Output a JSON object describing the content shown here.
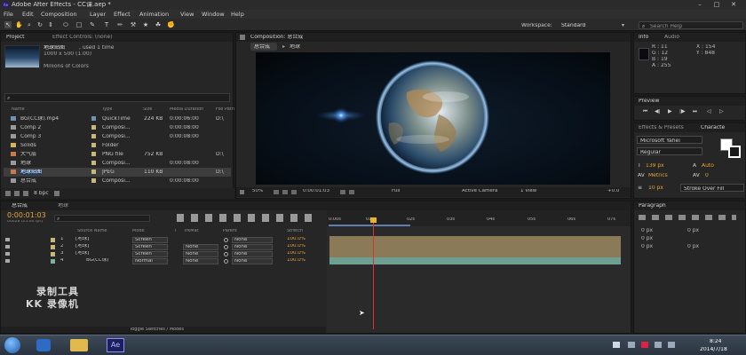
{
  "titlebar": {
    "icon_text": "Ae",
    "title": "Adobe After Effects - CC课.aep *"
  },
  "menubar": {
    "items": [
      "File",
      "Edit",
      "Composition",
      "Layer",
      "Effect",
      "Animation",
      "View",
      "Window",
      "Help"
    ]
  },
  "toolbar": {
    "tools": [
      "↖",
      "✋",
      "⌕",
      "↻",
      "⇕",
      "⬭",
      "□",
      "✎",
      "T",
      "✏",
      "⚒",
      "★",
      "☘",
      "✊"
    ],
    "workspace_label": "Workspace:",
    "workspace_value": "Standard",
    "search_placeholder": "Search Help"
  },
  "project": {
    "tabs": [
      "Project",
      "Effect Controls: (none)"
    ],
    "selected_name": "地球贴图",
    "used_text": ", used 1 time",
    "dimensions": "1000 x 500 (1.00)",
    "color_text": "Millions of Colors",
    "search_icon": "⌕",
    "columns": [
      "Name",
      "Type",
      "Size",
      "Media Duration",
      "File Path"
    ],
    "rows": [
      {
        "name": "BG(CC球).mp4",
        "type": "QuickTime",
        "size": "224 KB",
        "duration": "0:00:06:00",
        "path": "D:\\",
        "color": "#6f8fb3"
      },
      {
        "name": "Comp 2",
        "type": "Composi...",
        "size": "",
        "duration": "0:00:08:00",
        "path": "",
        "color": "#c9b77a"
      },
      {
        "name": "Comp 3",
        "type": "Composi...",
        "size": "",
        "duration": "0:00:08:00",
        "path": "",
        "color": "#c9b77a"
      },
      {
        "name": "Solids",
        "type": "Folder",
        "size": "",
        "duration": "",
        "path": "",
        "color": "#c9b77a"
      },
      {
        "name": "大气层",
        "type": "PNG file",
        "size": "752 KB",
        "duration": "",
        "path": "D:\\",
        "color": "#c9b77a"
      },
      {
        "name": "地球",
        "type": "Composi...",
        "size": "",
        "duration": "0:00:08:00",
        "path": "",
        "color": "#c9b77a"
      },
      {
        "name": "地球贴图",
        "type": "JPEG",
        "size": "110 KB",
        "duration": "",
        "path": "D:\\",
        "color": "#c9b77a",
        "selected": true
      },
      {
        "name": "总合成",
        "type": "Composi...",
        "size": "",
        "duration": "0:00:08:00",
        "path": "",
        "color": "#c9b77a"
      }
    ],
    "bpc": "8 bpc"
  },
  "comp": {
    "tab": "Composition: 总合成",
    "breadcrumbs": [
      "总合成",
      "地球"
    ],
    "controls": [
      "50%",
      "0:00:01:03",
      "Full",
      "Active Camera",
      "1 View",
      "+0.0"
    ]
  },
  "info": {
    "tabs": [
      "Info",
      "Audio"
    ],
    "r": "R : 11",
    "g": "G : 12",
    "b": "B : 19",
    "a": "A : 255",
    "x": "X : 154",
    "y": "Y : 848"
  },
  "preview": {
    "tab": "Preview",
    "buttons": [
      "⏮",
      "◀|",
      "▶",
      "|▶",
      "⏭",
      "◁",
      "▷"
    ]
  },
  "character": {
    "tabs": [
      "Effects & Presets",
      "Characte"
    ],
    "font": "Microsoft Yahei",
    "style": "Regular",
    "size": "139 px",
    "leading": "Auto",
    "kerning": "Metrics",
    "tracking": "0",
    "stroke_width": "10 px",
    "stroke_mode": "Stroke Over Fill"
  },
  "paragraph": {
    "tab": "Paragraph",
    "values": [
      "0 px",
      "0 px",
      "0 px",
      "0 px",
      "0 px"
    ]
  },
  "timeline": {
    "tabs": [
      "总合成",
      "地球"
    ],
    "timecode": "0:00:01:03",
    "fps": "00028 (25.00 fps)",
    "search_icon": "⌕",
    "columns": [
      "Source Name",
      "Mode",
      "T",
      "TrkMat",
      "Parent",
      "Stretch"
    ],
    "ruler": [
      "0:00s",
      "01s",
      "02s",
      "03s",
      "04s",
      "05s",
      "06s",
      "07s"
    ],
    "layers": [
      {
        "num": "1",
        "name": "[地球]",
        "mode": "Screen",
        "trkmat": "",
        "parent": "None",
        "stretch": "100.0%",
        "color": "#c9b77a"
      },
      {
        "num": "2",
        "name": "[地球]",
        "mode": "Screen",
        "trkmat": "None",
        "parent": "None",
        "stretch": "100.0%",
        "color": "#c9b77a"
      },
      {
        "num": "3",
        "name": "[地球]",
        "mode": "Screen",
        "trkmat": "None",
        "parent": "None",
        "stretch": "100.0%",
        "color": "#c9b77a"
      },
      {
        "num": "4",
        "name": "BG(CC球)",
        "mode": "Normal",
        "trkmat": "None",
        "parent": "None",
        "stretch": "100.0%",
        "color": "#7bb0a3"
      }
    ],
    "toggle_label": "Toggle Switches / Modes"
  },
  "watermark": {
    "line1": "录制工具",
    "line2": "KK 录像机"
  },
  "taskbar": {
    "ae_label": "Ae",
    "time": "8:24",
    "date": "2014/7/18"
  }
}
